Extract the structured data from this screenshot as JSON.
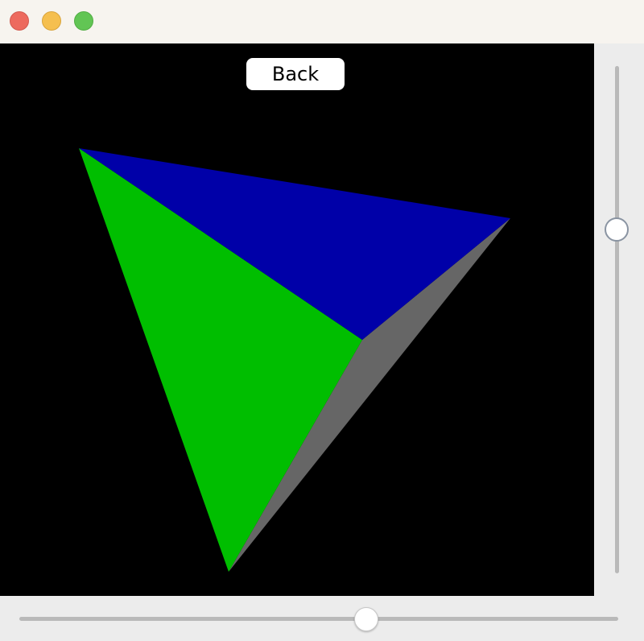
{
  "window": {
    "traffic_lights": [
      {
        "name": "close",
        "color": "#ed6a5e"
      },
      {
        "name": "minimize",
        "color": "#f5bf4f"
      },
      {
        "name": "maximize",
        "color": "#62c554"
      }
    ]
  },
  "canvas": {
    "background": "#000000",
    "back_label": "Back",
    "faces": [
      {
        "name": "blue-face",
        "color": "#0000a8"
      },
      {
        "name": "green-face",
        "color": "#00be00"
      },
      {
        "name": "gray-face",
        "color": "#666666"
      }
    ]
  },
  "sliders": {
    "vertical": {
      "value": 0.3
    },
    "horizontal": {
      "value": 0.58
    }
  }
}
